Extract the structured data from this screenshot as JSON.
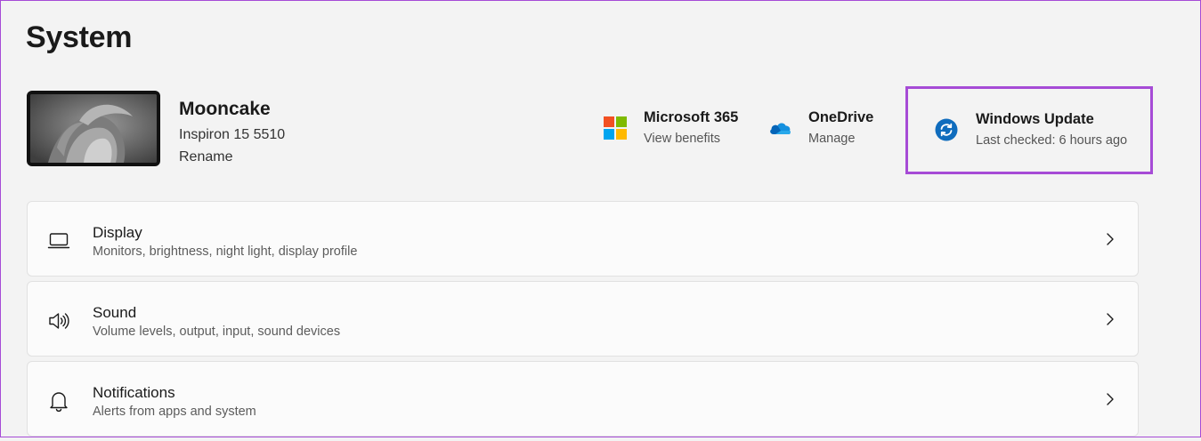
{
  "page": {
    "title": "System"
  },
  "device": {
    "name": "Mooncake",
    "model": "Inspiron 15 5510",
    "rename_label": "Rename"
  },
  "quick_links": [
    {
      "title": "Microsoft 365",
      "subtitle": "View benefits",
      "icon": "microsoft-logo-icon"
    },
    {
      "title": "OneDrive",
      "subtitle": "Manage",
      "icon": "onedrive-cloud-icon"
    },
    {
      "title": "Windows Update",
      "subtitle": "Last checked: 6 hours ago",
      "icon": "windows-update-icon",
      "highlighted": true
    }
  ],
  "settings": [
    {
      "title": "Display",
      "subtitle": "Monitors, brightness, night light, display profile",
      "icon": "laptop-icon"
    },
    {
      "title": "Sound",
      "subtitle": "Volume levels, output, input, sound devices",
      "icon": "speaker-icon"
    },
    {
      "title": "Notifications",
      "subtitle": "Alerts from apps and system",
      "icon": "bell-icon"
    }
  ],
  "colors": {
    "highlight_border": "#a64bd6",
    "update_blue": "#0f6cbd",
    "onedrive_blue": "#0364b8",
    "ms_red": "#f25022",
    "ms_green": "#7fba00",
    "ms_blue": "#00a4ef",
    "ms_yellow": "#ffb900"
  }
}
